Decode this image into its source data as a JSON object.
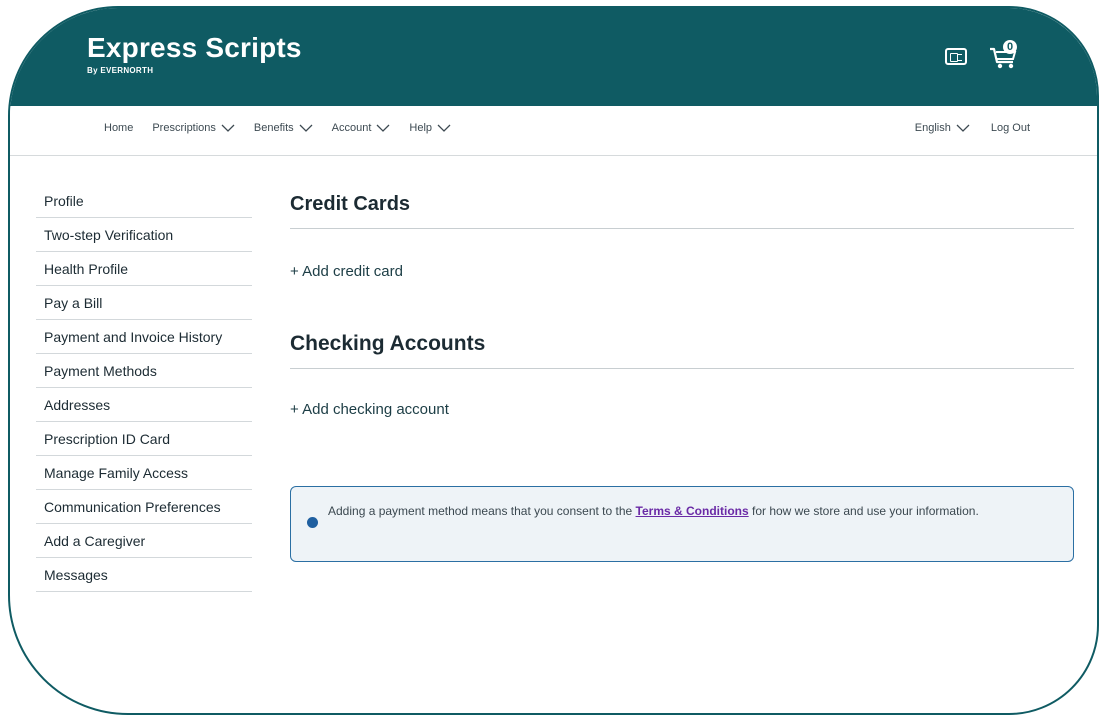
{
  "header": {
    "brand": "Express Scripts",
    "brand_sub": "By EVERNORTH",
    "cart_count": "0",
    "colors": {
      "header_bg": "#0f5b63"
    },
    "icons": [
      "id-card-icon",
      "cart-icon"
    ]
  },
  "nav": {
    "left": [
      {
        "label": "Home",
        "has_dropdown": false
      },
      {
        "label": "Prescriptions",
        "has_dropdown": true
      },
      {
        "label": "Benefits",
        "has_dropdown": true
      },
      {
        "label": "Account",
        "has_dropdown": true
      },
      {
        "label": "Help",
        "has_dropdown": true
      }
    ],
    "right": [
      {
        "label": "English",
        "has_dropdown": true
      },
      {
        "label": "Log Out",
        "has_dropdown": false
      }
    ]
  },
  "sidebar": {
    "items": [
      "Profile",
      "Two-step Verification",
      "Health Profile",
      "Pay a Bill",
      "Payment and Invoice History",
      "Payment Methods",
      "Addresses",
      "Prescription ID Card",
      "Manage Family Access",
      "Communication Preferences",
      "Add a Caregiver",
      "Messages"
    ]
  },
  "main": {
    "credit_cards_title": "Credit Cards",
    "add_credit_card": "+ Add credit card",
    "checking_title": "Checking Accounts",
    "add_checking": "+ Add checking account",
    "notice": {
      "text_before": "Adding a payment method means that you consent to the ",
      "link": "Terms & Conditions",
      "text_after": " for how we store and use your information."
    }
  }
}
